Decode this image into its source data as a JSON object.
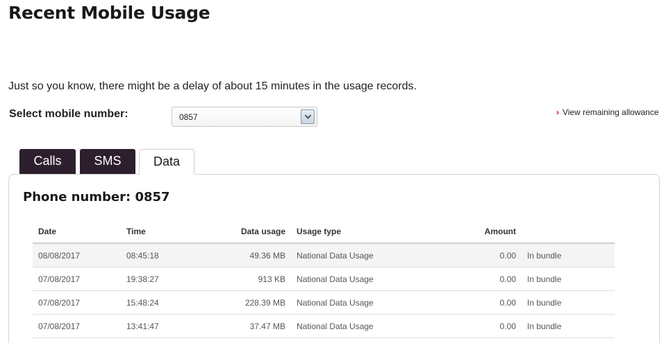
{
  "page": {
    "title": "Recent Mobile Usage",
    "notice": "Just so you know, there might be a delay of about 15 minutes in the usage records."
  },
  "selector": {
    "label": "Select mobile number:",
    "selected_value": "0857"
  },
  "allowance_link": {
    "label": "View remaining allowance"
  },
  "tabs": [
    {
      "label": "Calls",
      "active": false
    },
    {
      "label": "SMS",
      "active": false
    },
    {
      "label": "Data",
      "active": true
    }
  ],
  "panel": {
    "heading": "Phone number: 0857"
  },
  "table": {
    "headers": [
      "Date",
      "Time",
      "Data usage",
      "Usage type",
      "Amount",
      ""
    ],
    "rows": [
      [
        "08/08/2017",
        "08:45:18",
        "49.36 MB",
        "National Data Usage",
        "0.00",
        "In bundle"
      ],
      [
        "07/08/2017",
        "19:38:27",
        "913 KB",
        "National Data Usage",
        "0.00",
        "In bundle"
      ],
      [
        "07/08/2017",
        "15:48:24",
        "228.39 MB",
        "National Data Usage",
        "0.00",
        "In bundle"
      ],
      [
        "07/08/2017",
        "13:41:47",
        "37.47 MB",
        "National Data Usage",
        "0.00",
        "In bundle"
      ]
    ]
  },
  "colors": {
    "tab_dark": "#2e1f2e",
    "link_chevron": "#d0021b"
  },
  "icons": {
    "dropdown": "chevron-down-icon",
    "link": "chevron-right-icon"
  }
}
